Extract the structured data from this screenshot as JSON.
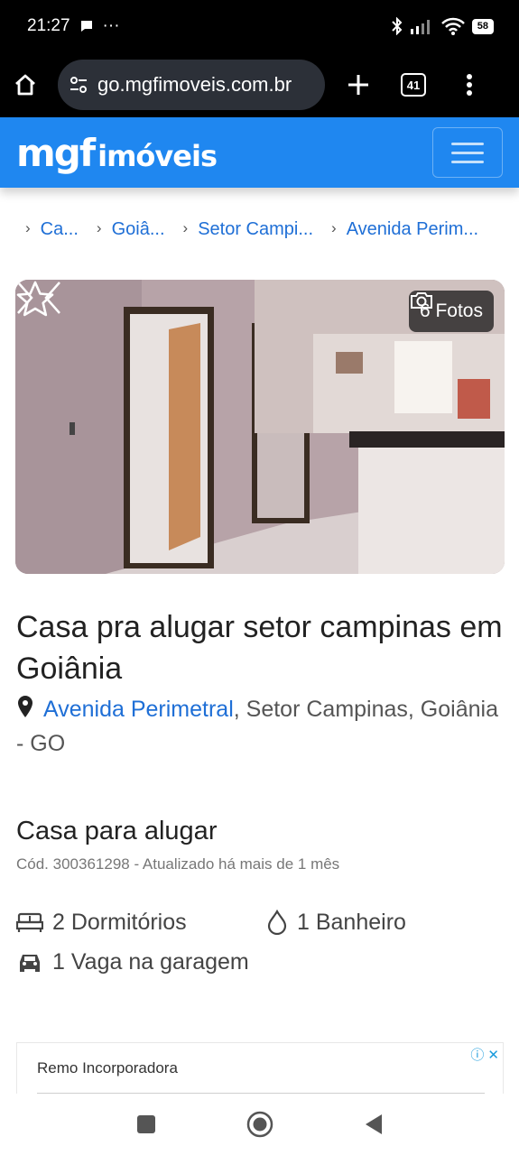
{
  "status_bar": {
    "time": "21:27",
    "dots": "···",
    "battery": "58"
  },
  "browser": {
    "url": "go.mgfimoveis.com.br",
    "tab_count": "41"
  },
  "site": {
    "logo_main": "mgf",
    "logo_sub": "imóveis",
    "brand_color": "#1f87f0"
  },
  "breadcrumb": [
    {
      "label": "Ca..."
    },
    {
      "label": "Goiâ..."
    },
    {
      "label": "Setor Campi..."
    },
    {
      "label": "Avenida Perim..."
    }
  ],
  "gallery": {
    "photo_count_label": "6 Fotos"
  },
  "listing": {
    "title": "Casa pra alugar setor campinas em Goiânia",
    "street": "Avenida Perimetral",
    "address_rest": ", Setor Campinas, Goiânia - GO",
    "subtitle": "Casa para alugar",
    "code_line": "Cód. 300361298 - Atualizado há mais de 1 mês",
    "bedrooms": "2 Dormitórios",
    "bathrooms": "1 Banheiro",
    "parking": "1 Vaga na garagem"
  },
  "ad": {
    "title": "Remo Incorporadora",
    "info": "ⓘ",
    "close": "✕"
  }
}
